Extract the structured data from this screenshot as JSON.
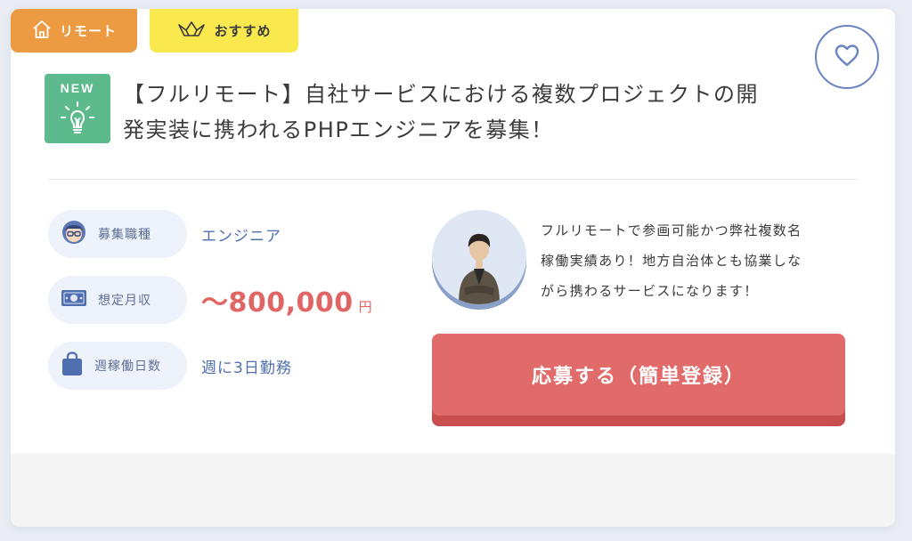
{
  "tags": {
    "remote": "リモート",
    "recommended": "おすすめ"
  },
  "badge": {
    "new": "NEW"
  },
  "job": {
    "title_line1": "【フルリモート】自社サービスにおける複数プロジェクトの開",
    "title_line2": "発実装に携われるPHPエンジニアを募集！"
  },
  "info": {
    "role": {
      "label": "募集職種",
      "value": "エンジニア",
      "icon": "person-glasses-icon"
    },
    "salary": {
      "label": "想定月収",
      "value": "〜800,000",
      "unit": "円",
      "icon": "money-icon"
    },
    "days": {
      "label": "週稼働日数",
      "value": "週に3日勤務",
      "icon": "bag-icon"
    }
  },
  "description": {
    "line1": "フルリモートで参画可能かつ弊社複数名",
    "line2": "稼働実績あり！地方自治体とも協業しな",
    "line3": "がら携わるサービスになります！"
  },
  "apply_button": "応募する（簡単登録）",
  "colors": {
    "remote_tag": "#ec9b43",
    "recommended_tag": "#fae84f",
    "new_badge": "#5cba8d",
    "accent_blue": "#4f6fb0",
    "salary": "#e06565",
    "apply": "#e16a6a"
  }
}
